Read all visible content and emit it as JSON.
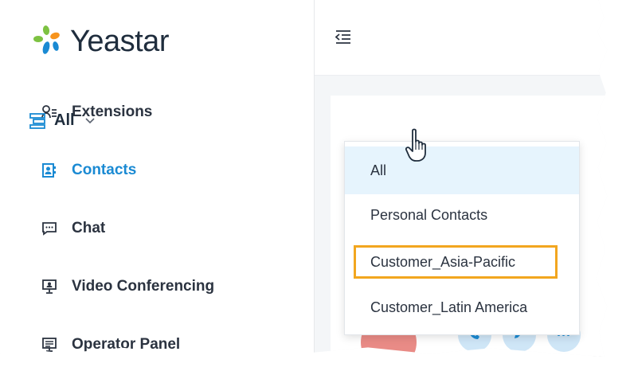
{
  "app": {
    "brand": "Yeastar"
  },
  "sidebar": {
    "items": [
      {
        "label": "Extensions",
        "icon": "extensions-icon",
        "active": false
      },
      {
        "label": "Contacts",
        "icon": "contacts-icon",
        "active": true
      },
      {
        "label": "Chat",
        "icon": "chat-icon",
        "active": false
      },
      {
        "label": "Video Conferencing",
        "icon": "video-conferencing-icon",
        "active": false
      },
      {
        "label": "Operator Panel",
        "icon": "operator-panel-icon",
        "active": false
      }
    ]
  },
  "main": {
    "filter": {
      "selected": "All"
    },
    "dropdown": {
      "options": [
        "All",
        "Personal Contacts",
        "Customer_Asia-Pacific",
        "Customer_Latin America"
      ],
      "selected_index": 0,
      "highlighted_index": 2
    },
    "actions": [
      {
        "icon": "phone-icon"
      },
      {
        "icon": "edit-icon"
      },
      {
        "icon": "more-icon",
        "label": "···"
      }
    ]
  },
  "colors": {
    "accent": "#1a8ad3",
    "highlight": "#f2a61f",
    "selected_bg": "#e6f4fd",
    "logo_green": "#7dc242",
    "logo_orange": "#f7941d",
    "logo_blue": "#1a8ad3"
  }
}
